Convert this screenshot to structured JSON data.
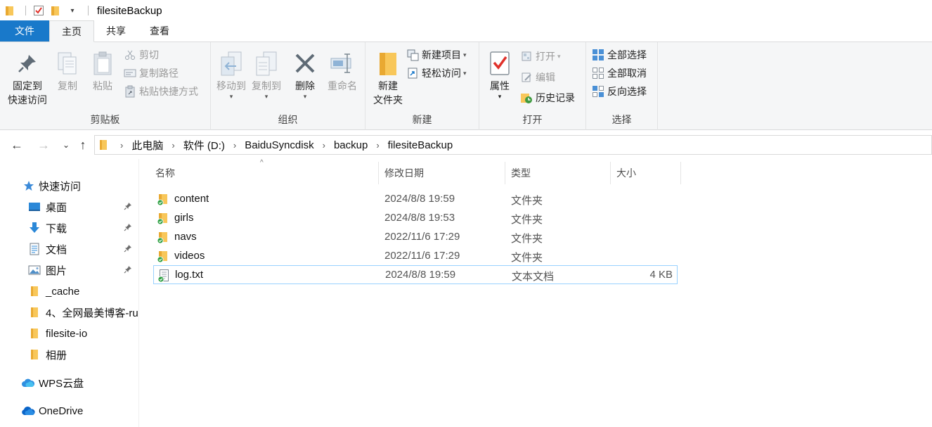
{
  "window": {
    "title": "filesiteBackup"
  },
  "ribbon_tabs": [
    {
      "label": "文件"
    },
    {
      "label": "主页"
    },
    {
      "label": "共享"
    },
    {
      "label": "查看"
    }
  ],
  "ribbon": {
    "clipboard": {
      "label": "剪贴板",
      "pin_line1": "固定到",
      "pin_line2": "快速访问",
      "copy": "复制",
      "paste": "粘贴",
      "cut": "剪切",
      "copy_path": "复制路径",
      "paste_shortcut": "粘贴快捷方式"
    },
    "organize": {
      "label": "组织",
      "move_to": "移动到",
      "copy_to": "复制到",
      "delete": "删除",
      "rename": "重命名"
    },
    "new": {
      "label": "新建",
      "new_folder_line1": "新建",
      "new_folder_line2": "文件夹",
      "new_item": "新建项目",
      "easy_access": "轻松访问"
    },
    "open": {
      "label": "打开",
      "properties": "属性",
      "open": "打开",
      "edit": "编辑",
      "history": "历史记录"
    },
    "select": {
      "label": "选择",
      "select_all": "全部选择",
      "select_none": "全部取消",
      "invert": "反向选择"
    }
  },
  "address": {
    "breadcrumbs": [
      "此电脑",
      "软件 (D:)",
      "BaiduSyncdisk",
      "backup",
      "filesiteBackup"
    ]
  },
  "navpane": {
    "items": [
      {
        "label": "快速访问",
        "icon": "star-icon"
      },
      {
        "label": "桌面",
        "icon": "desktop-icon"
      },
      {
        "label": "下载",
        "icon": "download-icon"
      },
      {
        "label": "文档",
        "icon": "document-icon"
      },
      {
        "label": "图片",
        "icon": "picture-icon"
      },
      {
        "label": "_cache",
        "icon": "folder-icon"
      },
      {
        "label": "4、全网最美博客-ru",
        "icon": "folder-icon"
      },
      {
        "label": "filesite-io",
        "icon": "folder-icon"
      },
      {
        "label": "相册",
        "icon": "folder-icon"
      },
      {
        "label": "WPS云盘",
        "icon": "cloud-icon"
      },
      {
        "label": "OneDrive",
        "icon": "cloud-icon"
      }
    ]
  },
  "filelist": {
    "columns": {
      "name": "名称",
      "modified": "修改日期",
      "type": "类型",
      "size": "大小"
    },
    "rows": [
      {
        "name": "content",
        "modified": "2024/8/8 19:59",
        "type": "文件夹",
        "size": ""
      },
      {
        "name": "girls",
        "modified": "2024/8/8 19:53",
        "type": "文件夹",
        "size": ""
      },
      {
        "name": "navs",
        "modified": "2022/11/6 17:29",
        "type": "文件夹",
        "size": ""
      },
      {
        "name": "videos",
        "modified": "2022/11/6 17:29",
        "type": "文件夹",
        "size": ""
      },
      {
        "name": "log.txt",
        "modified": "2024/8/8 19:59",
        "type": "文本文档",
        "size": "4 KB"
      }
    ]
  },
  "colors": {
    "accent": "#1979ca",
    "folder": "#f8c75a",
    "sync_check": "#2ea043",
    "selection": "#99d1ff"
  }
}
